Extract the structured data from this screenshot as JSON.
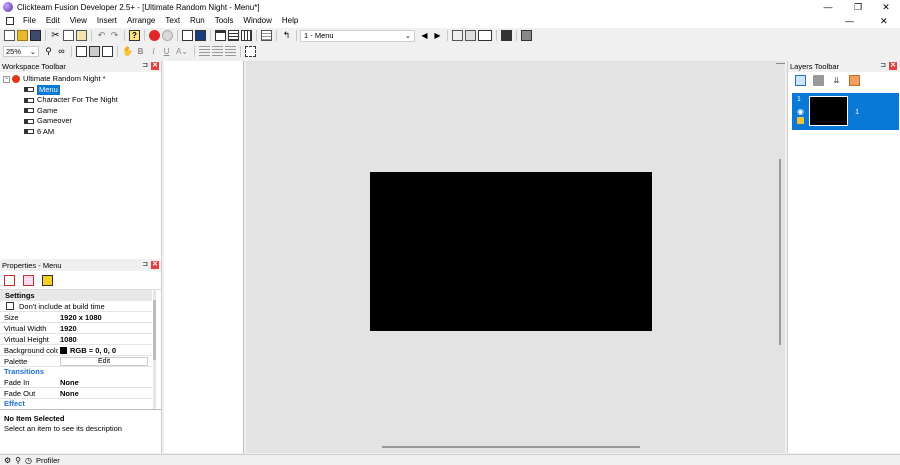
{
  "window": {
    "title": "Clickteam Fusion Developer 2.5+ - [Ultimate Random Night - Menu*]",
    "min_glyph": "—",
    "max_glyph": "❐",
    "close_glyph": "✕",
    "inner_min_glyph": "—",
    "inner_close_glyph": "✕"
  },
  "menu": [
    "File",
    "Edit",
    "View",
    "Insert",
    "Arrange",
    "Text",
    "Run",
    "Tools",
    "Window",
    "Help"
  ],
  "toolbar": {
    "frame_select": "1 - Menu",
    "zoom": "25%"
  },
  "workspace": {
    "title": "Workspace Toolbar",
    "app_name": "Ultimate Random Night *",
    "frames": [
      "Menu",
      "Character For The Night",
      "Game",
      "Gameover",
      "6 AM"
    ],
    "selected": 0
  },
  "properties": {
    "title": "Properties - Menu",
    "settings_header": "Settings",
    "build_checkbox": "Don't include at build time",
    "rows": [
      {
        "key": "Size",
        "value": "1920 x 1080"
      },
      {
        "key": "Virtual Width",
        "value": "1920"
      },
      {
        "key": "Virtual Height",
        "value": "1080"
      }
    ],
    "bg_key": "Background color",
    "bg_value": "RGB = 0, 0, 0",
    "bg_color": "#000000",
    "palette_key": "Palette",
    "palette_button": "Edit",
    "transitions_header": "Transitions",
    "transition_rows": [
      {
        "key": "Fade In",
        "value": "None"
      },
      {
        "key": "Fade Out",
        "value": "None"
      }
    ],
    "effect_header": "Effect",
    "desc_title": "No Item Selected",
    "desc_text": "Select an item to see its description"
  },
  "layers": {
    "title": "Layers Toolbar",
    "layer_number": "1",
    "layer_label": "1"
  },
  "statusbar": {
    "profiler": "Profiler"
  },
  "colors": {
    "accent": "#0a78d7",
    "frame_bg": "#000000",
    "editor_bg": "#e3e3e3"
  },
  "pin_glyph": "⊐",
  "close_glyph": "✕"
}
